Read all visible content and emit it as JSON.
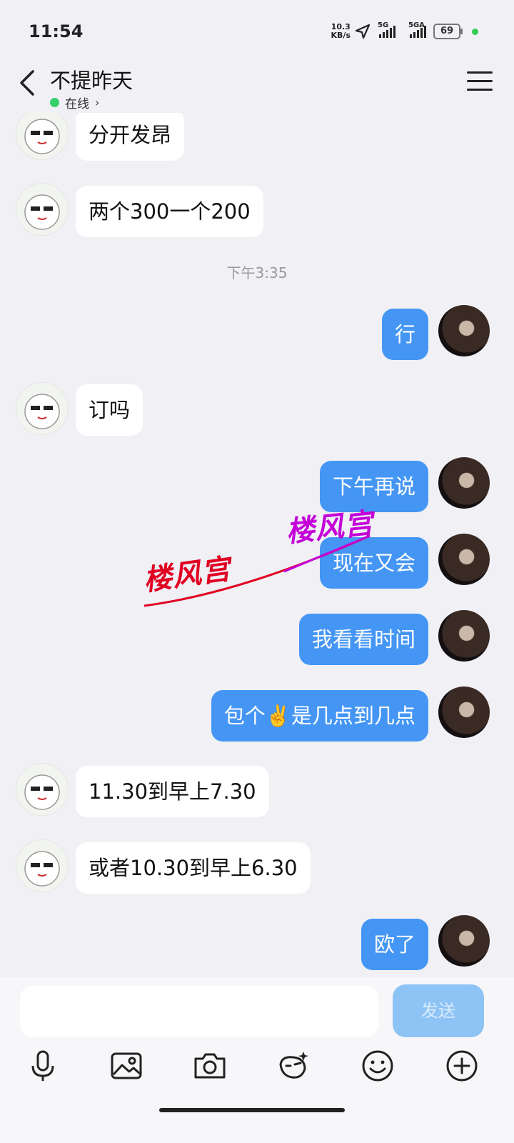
{
  "status_bar": {
    "time": "11:54",
    "net_speed_value": "10.3",
    "net_speed_unit": "KB/s",
    "sim1_label": "5G",
    "sim2_label": "5GA",
    "battery_level": "69"
  },
  "header": {
    "title": "不提昨天",
    "online_text": "在线",
    "online_chevron": "›"
  },
  "timestamp": "下午3:35",
  "messages": [
    {
      "side": "in",
      "text": "分开发昂"
    },
    {
      "side": "in",
      "text": "两个300一个200"
    },
    {
      "side": "out",
      "text": "行"
    },
    {
      "side": "in",
      "text": "订吗"
    },
    {
      "side": "out",
      "text": "下午再说"
    },
    {
      "side": "out",
      "text": "现在又会"
    },
    {
      "side": "out",
      "text": "我看看时间"
    },
    {
      "side": "out",
      "text": "包个✌️是几点到几点"
    },
    {
      "side": "in",
      "text": "11.30到早上7.30"
    },
    {
      "side": "in",
      "text": "或者10.30到早上6.30"
    },
    {
      "side": "out",
      "text": "欧了"
    }
  ],
  "watermark": {
    "text1": "楼风宫",
    "text2": "楼风宫"
  },
  "composer": {
    "input_value": "",
    "send_label": "发送"
  },
  "toolbar_icons": [
    "microphone-icon",
    "image-icon",
    "camera-icon",
    "sticker-icon",
    "emoji-icon",
    "plus-icon"
  ],
  "colors": {
    "background": "#f0f0f5",
    "outgoing_bubble": "#4596f4",
    "incoming_bubble": "#ffffff",
    "send_button": "#8ec3f5",
    "online_dot": "#35d06a"
  }
}
